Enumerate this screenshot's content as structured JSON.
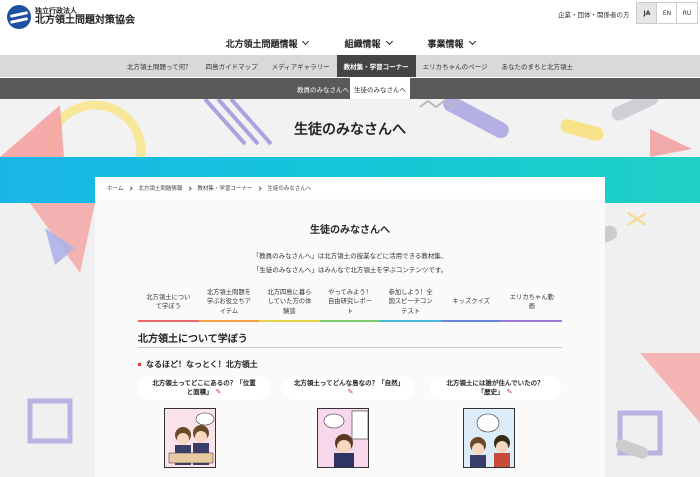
{
  "header": {
    "logo_sub": "独立行政法人",
    "logo_main": "北方領土問題対策協会",
    "util_link": "企業・団体・関係者の方",
    "languages": [
      {
        "code": "JA",
        "active": true
      },
      {
        "code": "EN",
        "active": false
      },
      {
        "code": "RU",
        "active": false
      }
    ]
  },
  "main_nav": [
    {
      "label": "北方領土問題情報"
    },
    {
      "label": "組織情報"
    },
    {
      "label": "事業情報"
    }
  ],
  "sub_nav": [
    {
      "label": "北方領土問題って何？"
    },
    {
      "label": "四島ガイドマップ"
    },
    {
      "label": "メディアギャラリー"
    },
    {
      "label": "教材集・学習コーナー",
      "active": true
    },
    {
      "label": "エリカちゃんのページ"
    },
    {
      "label": "あなたのまちと北方領土"
    }
  ],
  "sub_nav2": [
    {
      "label": "教員のみなさんへ"
    },
    {
      "label": "生徒のみなさんへ",
      "active": true
    }
  ],
  "hero": {
    "title": "生徒のみなさんへ"
  },
  "breadcrumb": [
    "ホーム",
    "北方領土問題情報",
    "教材集・学習コーナー",
    "生徒のみなさんへ"
  ],
  "page": {
    "title": "生徒のみなさんへ",
    "intro_line1": "「教員のみなさんへ」は北方領土の授業などに活用できる教材集、",
    "intro_line2": "「生徒のみなさんへ」はみんなで北方領土を学ぶコンテンツです。"
  },
  "tabs": [
    {
      "line1": "北方領土につい",
      "line2": "て学ぼう"
    },
    {
      "line1": "北方領土問題を",
      "line2": "学ぶお役立ちア",
      "line3": "イテム"
    },
    {
      "line1": "北方四島に暮ら",
      "line2": "していた方の体",
      "line3": "験談"
    },
    {
      "line1": "やってみよう！",
      "line2": "自由研究レポー",
      "line3": "ト"
    },
    {
      "line1": "参加しよう！全",
      "line2": "国スピーチコン",
      "line3": "テスト"
    },
    {
      "line1": "キッズクイズ"
    },
    {
      "line1": "エリカちゃん動",
      "line2": "画"
    }
  ],
  "section": {
    "title": "北方領土について学ぼう",
    "subtitle": "なるほど！なっとく！北方領土"
  },
  "manga_cards": [
    {
      "line1": "北方領土ってどこにあるの？「位置",
      "line2": "と面積」"
    },
    {
      "line1": "北方領土ってどんな島なの？「自然」",
      "line2": ""
    },
    {
      "line1": "北方領土には誰が住んでいたの？",
      "line2": "「歴史」"
    }
  ],
  "icons": {
    "pen": "pencil-icon"
  },
  "colors": {
    "brand": "#1e4fa0",
    "band_start": "#1ab6e8",
    "band_end": "#1fd1c5",
    "active_subnav": "#444444",
    "bullet": "#e03a3a"
  }
}
